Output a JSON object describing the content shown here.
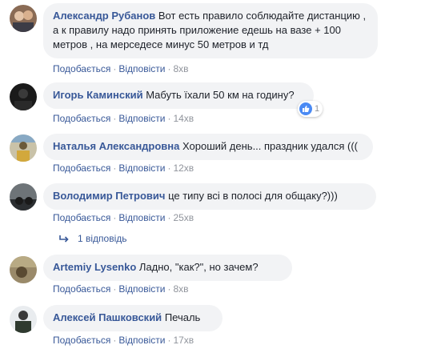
{
  "comments": [
    {
      "author": "Александр Рубанов",
      "text_line1": "Вот есть правило соблюдайте дистанцию ,",
      "text_line2": "а к правилу надо принять приложение едешь на вазе + 100",
      "text_line3": "метров , на мерседесе минус 50 метров и тд",
      "like": "Подобається",
      "reply": "Відповісти",
      "time": "8хв"
    },
    {
      "author": "Игорь Каминский",
      "text": "Мабуть їхали 50 км на годину?",
      "like": "Подобається",
      "reply": "Відповісти",
      "time": "14хв",
      "reaction_count": "1"
    },
    {
      "author": "Наталья Александровна",
      "text": "Хороший день... праздник удался (((",
      "like": "Подобається",
      "reply": "Відповісти",
      "time": "12хв"
    },
    {
      "author": "Володимир Петрович",
      "text": "це типу всі в полосі для общаку?)))",
      "like": "Подобається",
      "reply": "Відповісти",
      "time": "25хв",
      "replies_label": "1 відповідь"
    },
    {
      "author": "Artemiy Lysenko",
      "text": "Ладно, \"как?\", но зачем?",
      "like": "Подобається",
      "reply": "Відповісти",
      "time": "8хв"
    },
    {
      "author": "Алексей Пашковский",
      "text": "Печаль",
      "like": "Подобається",
      "reply": "Відповісти",
      "time": "17хв"
    }
  ],
  "separator": "·",
  "colors": {
    "author": "#385898",
    "bubble": "#f2f3f5",
    "meta": "#90949c",
    "like_badge": "#4a8af4"
  },
  "icons": [
    "like-icon",
    "reply-arrow-icon"
  ]
}
